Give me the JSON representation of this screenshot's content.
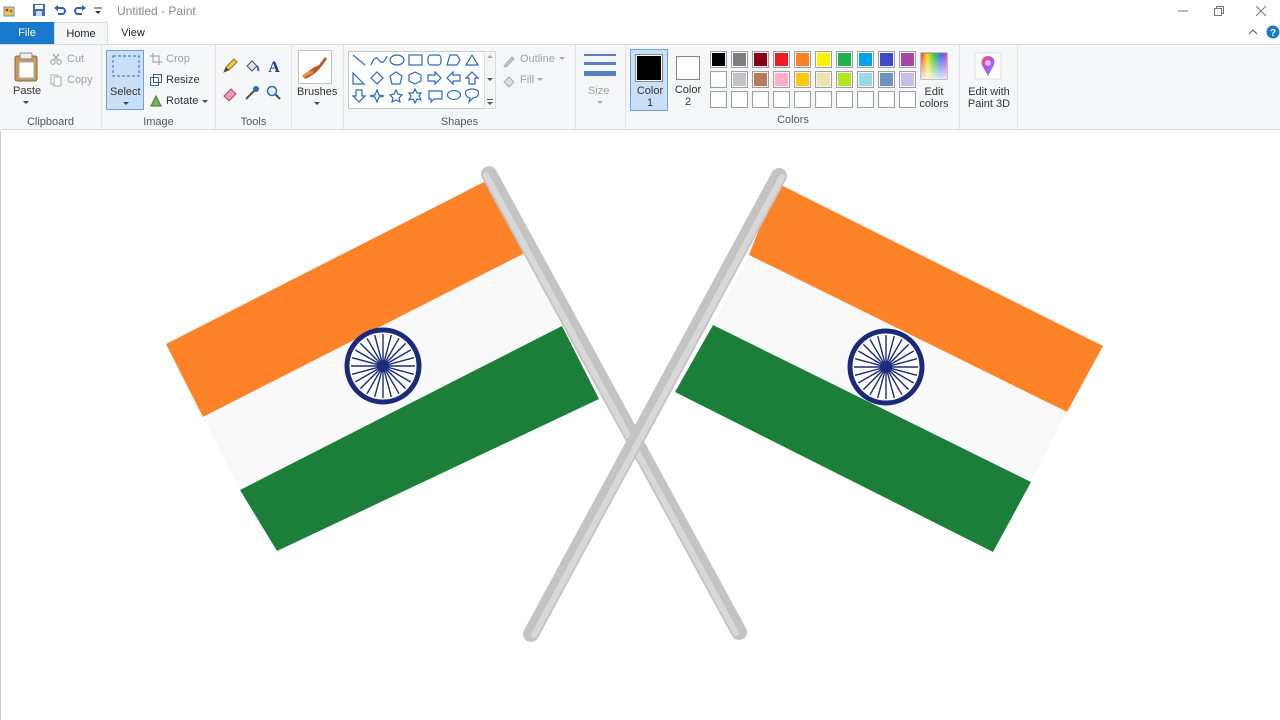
{
  "window": {
    "title": "Untitled - Paint"
  },
  "tabs": {
    "file": "File",
    "home": "Home",
    "view": "View"
  },
  "clipboard": {
    "paste": "Paste",
    "cut": "Cut",
    "copy": "Copy",
    "group": "Clipboard"
  },
  "image": {
    "select": "Select",
    "crop": "Crop",
    "resize": "Resize",
    "rotate": "Rotate",
    "group": "Image"
  },
  "tools": {
    "group": "Tools"
  },
  "brushes": {
    "label": "Brushes"
  },
  "shapes": {
    "outline": "Outline",
    "fill": "Fill",
    "group": "Shapes"
  },
  "size": {
    "label": "Size"
  },
  "colors": {
    "color1": "Color 1",
    "color2": "Color 2",
    "edit_colors": "Edit colors",
    "edit_paint3d": "Edit with Paint 3D",
    "group": "Colors",
    "color1_value": "#000000",
    "color2_value": "#ffffff",
    "palette_row1": [
      "#000000",
      "#7f7f7f",
      "#880015",
      "#ed1c24",
      "#ff7f27",
      "#fff200",
      "#22b14c",
      "#00a2e8",
      "#3f48cc",
      "#a349a4"
    ],
    "palette_row2": [
      "#ffffff",
      "#c3c3c3",
      "#b97a57",
      "#ffaec9",
      "#ffc90e",
      "#efe4b0",
      "#b5e61d",
      "#99d9ea",
      "#7092be",
      "#c8bfe7"
    ],
    "palette_row3": [
      "#ffffff",
      "#ffffff",
      "#ffffff",
      "#ffffff",
      "#ffffff",
      "#ffffff",
      "#ffffff",
      "#ffffff",
      "#ffffff",
      "#ffffff"
    ]
  },
  "drawing": {
    "flag_saffron": "#fd8228",
    "flag_white": "#f9f9f9",
    "flag_green": "#1b7f3a",
    "chakra": "#1c2a7a",
    "pole": "#c4c4c4"
  }
}
